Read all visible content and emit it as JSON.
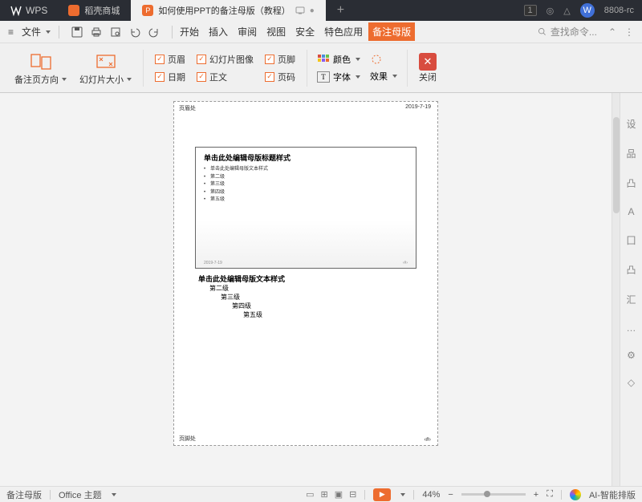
{
  "titlebar": {
    "app": "WPS",
    "tabs": [
      {
        "label": "稻壳商城",
        "icon_bg": "#ed6c2f"
      },
      {
        "label": "如何使用PPT的备注母版（教程）",
        "icon_bg": "#ed6c2f",
        "icon_letter": "P"
      }
    ],
    "right_badge": "1",
    "right_build": "8808-rc"
  },
  "menubar": {
    "file": "文件",
    "tabs": [
      "开始",
      "插入",
      "审阅",
      "视图",
      "安全",
      "特色应用",
      "备注母版"
    ],
    "search_placeholder": "查找命令..."
  },
  "ribbon": {
    "group1": "备注页方向",
    "group2": "幻灯片大小",
    "checks": {
      "header": "页眉",
      "slide_image": "幻灯片图像",
      "footer": "页脚",
      "date": "日期",
      "body": "正文",
      "page_number": "页码"
    },
    "color": "颜色",
    "font": "字体",
    "effect": "效果",
    "close": "关闭"
  },
  "page": {
    "header": "页眉处",
    "date": "2019-7-19",
    "footer": "页脚处",
    "pgnum": "‹#›",
    "slide_title": "单击此处编辑母版标题样式",
    "slide_levels": [
      "单击此处编辑母版文本样式",
      "第二级",
      "第三级",
      "第四级",
      "第五级"
    ],
    "slide_footer_date": "2019-7-19",
    "notes_title": "单击此处编辑母版文本样式",
    "notes_levels": [
      "第二级",
      "第三级",
      "第四级",
      "第五级"
    ]
  },
  "rail": [
    "设",
    "品",
    "凸",
    "A",
    "囗",
    "凸",
    "汇",
    "…",
    "⚙",
    "◇"
  ],
  "statusbar": {
    "mode": "备注母版",
    "theme": "Office 主题",
    "zoom": "44%",
    "ai": "AI-智能排版"
  }
}
